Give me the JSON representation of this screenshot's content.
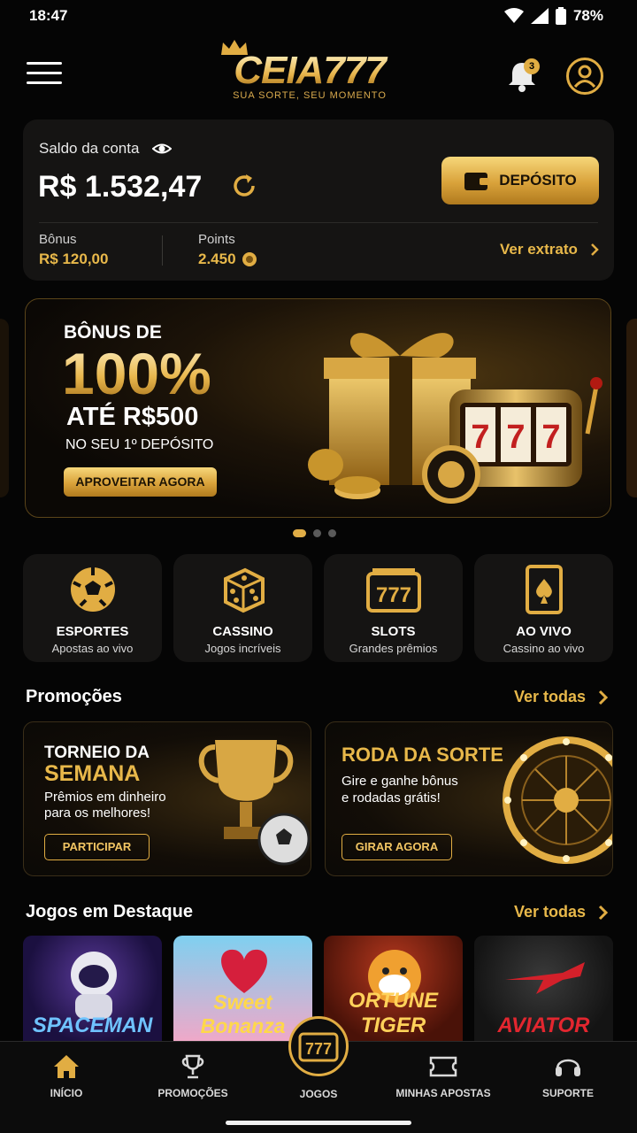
{
  "status_bar": {
    "time": "18:47",
    "battery": "78%"
  },
  "header": {
    "logo": "CEIA777",
    "tagline": "SUA SORTE, SEU MOMENTO",
    "notification_count": "3"
  },
  "balance": {
    "label": "Saldo da conta",
    "value": "R$ 1.532,47",
    "deposit_label": "DEPÓSITO",
    "bonus_label": "Bônus",
    "bonus_value": "R$ 120,00",
    "points_label": "Points",
    "points_value": "2.450",
    "statement_link": "Ver extrato"
  },
  "banner": {
    "line1": "BÔNUS DE",
    "percent": "100%",
    "line2": "ATÉ R$500",
    "line3": "NO SEU 1º DEPÓSITO",
    "cta": "APROVEITAR AGORA",
    "slot_symbols": [
      "7",
      "7",
      "7"
    ],
    "dots_total": 3,
    "dots_active": 1
  },
  "categories": [
    {
      "title": "ESPORTES",
      "subtitle": "Apostas ao vivo",
      "icon": "soccer-ball-icon"
    },
    {
      "title": "CASSINO",
      "subtitle": "Jogos incríveis",
      "icon": "dice-icon"
    },
    {
      "title": "SLOTS",
      "subtitle": "Grandes prêmios",
      "icon": "slot-machine-icon"
    },
    {
      "title": "AO VIVO",
      "subtitle": "Cassino ao vivo",
      "icon": "playing-card-icon"
    }
  ],
  "categories_slot_text": "777",
  "promotions": {
    "title": "Promoções",
    "see_all": "Ver todas",
    "cards": [
      {
        "title_line1": "TORNEIO DA",
        "title_line2": "SEMANA",
        "desc_line1": "Prêmios em dinheiro",
        "desc_line2": "para os melhores!",
        "cta": "PARTICIPAR"
      },
      {
        "title_line1": "RODA DA SORTE",
        "desc_line1": "Gire e ganhe bônus",
        "desc_line2": "e rodadas grátis!",
        "cta": "GIRAR AGORA"
      }
    ]
  },
  "featured": {
    "title": "Jogos em Destaque",
    "see_all": "Ver todas",
    "games": [
      "SPACEMAN",
      "Sweet Bonanza",
      "ORTUNE TIGER",
      "AVIATOR"
    ]
  },
  "bottom_nav": {
    "items": [
      "INÍCIO",
      "PROMOÇÕES",
      "JOGOS",
      "MINHAS APOSTAS",
      "SUPORTE"
    ],
    "center_text": "777",
    "active": "INÍCIO"
  },
  "colors": {
    "accent": "#e1ad43",
    "background": "#050505",
    "card": "#151413"
  }
}
